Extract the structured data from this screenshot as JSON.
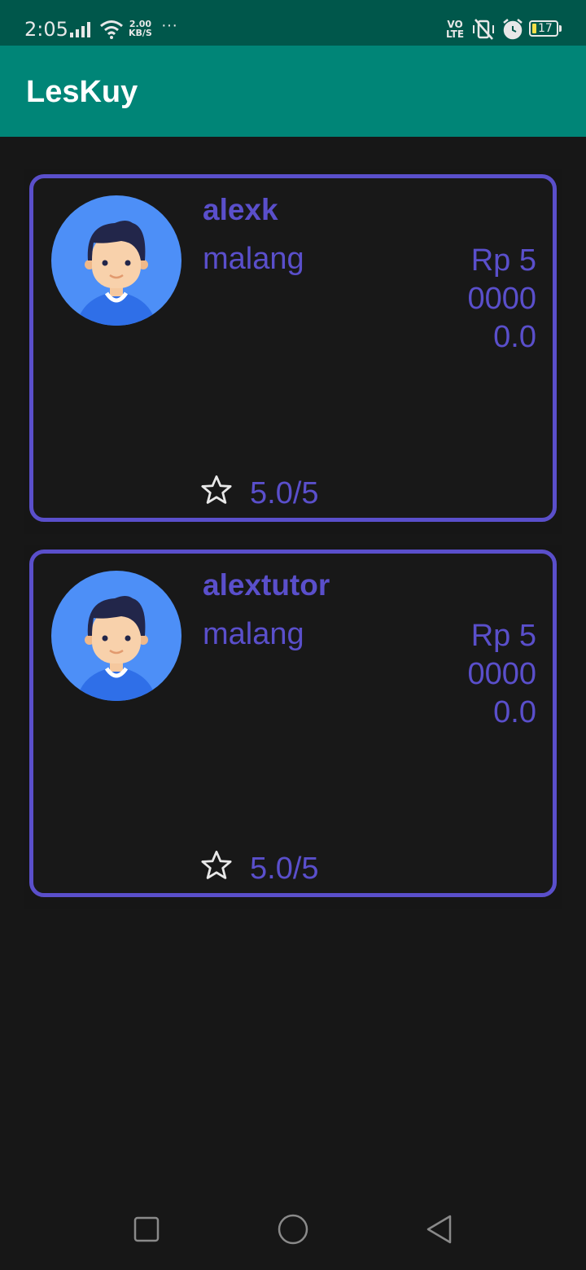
{
  "status_bar": {
    "time": "2:05",
    "speed_value": "2.00",
    "speed_unit": "KB/S",
    "more": "···",
    "volte_top": "VO",
    "volte_bottom": "LTE",
    "battery": "17"
  },
  "app": {
    "title": "LesKuy"
  },
  "tutors": [
    {
      "name": "alexk",
      "city": "malang",
      "price": "Rp 500000.0",
      "rating": "5.0/5"
    },
    {
      "name": "alextutor",
      "city": "malang",
      "price": "Rp 500000.0",
      "rating": "5.0/5"
    }
  ],
  "colors": {
    "accent": "#5a4fcb",
    "app_bar": "#008577",
    "status_bar": "#00574b",
    "background": "#171717"
  },
  "icons": {
    "avatar": "person-avatar-icon",
    "rating": "star-outline-icon",
    "nav": [
      "recent-apps-icon",
      "home-icon",
      "back-icon"
    ]
  }
}
